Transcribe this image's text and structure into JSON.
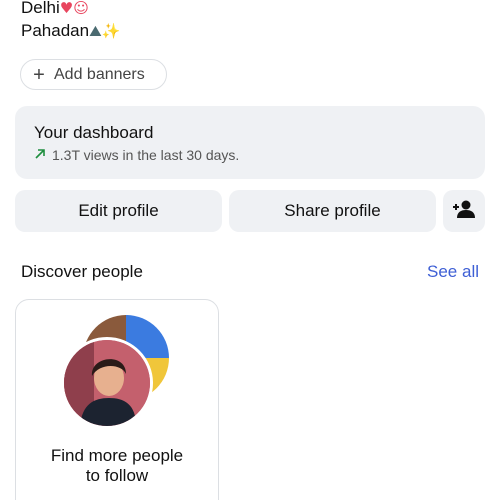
{
  "bio": {
    "line1": "Delhi",
    "line1_emoji": "♥☺",
    "line2": "Pahadan",
    "line2_emoji": "⛰✨"
  },
  "add_banners": {
    "label": "Add banners",
    "icon": "plus-icon"
  },
  "dashboard": {
    "title": "Your dashboard",
    "subtitle": "1.3T views in the last 30 days.",
    "trend_icon": "trending-up-icon"
  },
  "actions": {
    "edit_profile": "Edit profile",
    "share_profile": "Share profile",
    "add_person_icon": "person-add-icon"
  },
  "discover": {
    "title": "Discover people",
    "see_all": "See all",
    "card": {
      "line1": "Find more people",
      "line2": "to follow"
    }
  },
  "colors": {
    "accent": "#3e5fd5",
    "trend": "#1e8e3e",
    "surface": "#eff1f4",
    "border": "#dcdfe3"
  }
}
